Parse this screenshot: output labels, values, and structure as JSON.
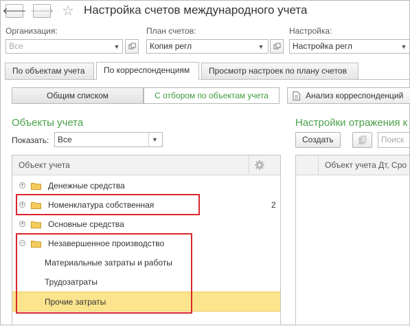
{
  "window": {
    "title": "Настройка счетов международного учета"
  },
  "nav": {
    "back_glyph": "🡐",
    "forward_glyph": "🡒",
    "star_glyph": "☆"
  },
  "filters": {
    "organization": {
      "label": "Организация:",
      "placeholder": "Все",
      "value": ""
    },
    "chart": {
      "label": "План счетов:",
      "value": "Копия регл"
    },
    "setting": {
      "label": "Настройка:",
      "value": "Настройка регл"
    }
  },
  "tabs": [
    {
      "label": "По объектам учета",
      "active": false
    },
    {
      "label": "По корреспонденциям",
      "active": true
    },
    {
      "label": "Просмотр настроек по плану счетов",
      "active": false
    }
  ],
  "mode": {
    "list_label": "Общим списком",
    "filter_label": "С отбором по объектам учета",
    "analysis_label": "Анализ корреспонденций"
  },
  "objects": {
    "title": "Объекты учета",
    "show_label": "Показать:",
    "show_value": "Все",
    "column_header": "Объект учета",
    "rows": [
      {
        "label": "Денежные средства",
        "expander": "+",
        "count": ""
      },
      {
        "label": "Номенклатура собственная",
        "expander": "+",
        "count": "2"
      },
      {
        "label": "Основные средства",
        "expander": "+",
        "count": ""
      },
      {
        "label": "Незавершенное производство",
        "expander": "−",
        "count": ""
      },
      {
        "label": "Материальные затраты и работы",
        "expander": "",
        "count": ""
      },
      {
        "label": "Трудозатраты",
        "expander": "",
        "count": ""
      },
      {
        "label": "Прочие затраты",
        "expander": "",
        "count": ""
      }
    ]
  },
  "settings_panel": {
    "title": "Настройки отражения к",
    "create_label": "Создать",
    "search_placeholder": "Поиск",
    "column_header": "Объект учета Дт, Сро"
  },
  "colors": {
    "accent_green": "#4aa04a",
    "highlight": "#fbe48d",
    "marker_red": "#d9262c"
  }
}
